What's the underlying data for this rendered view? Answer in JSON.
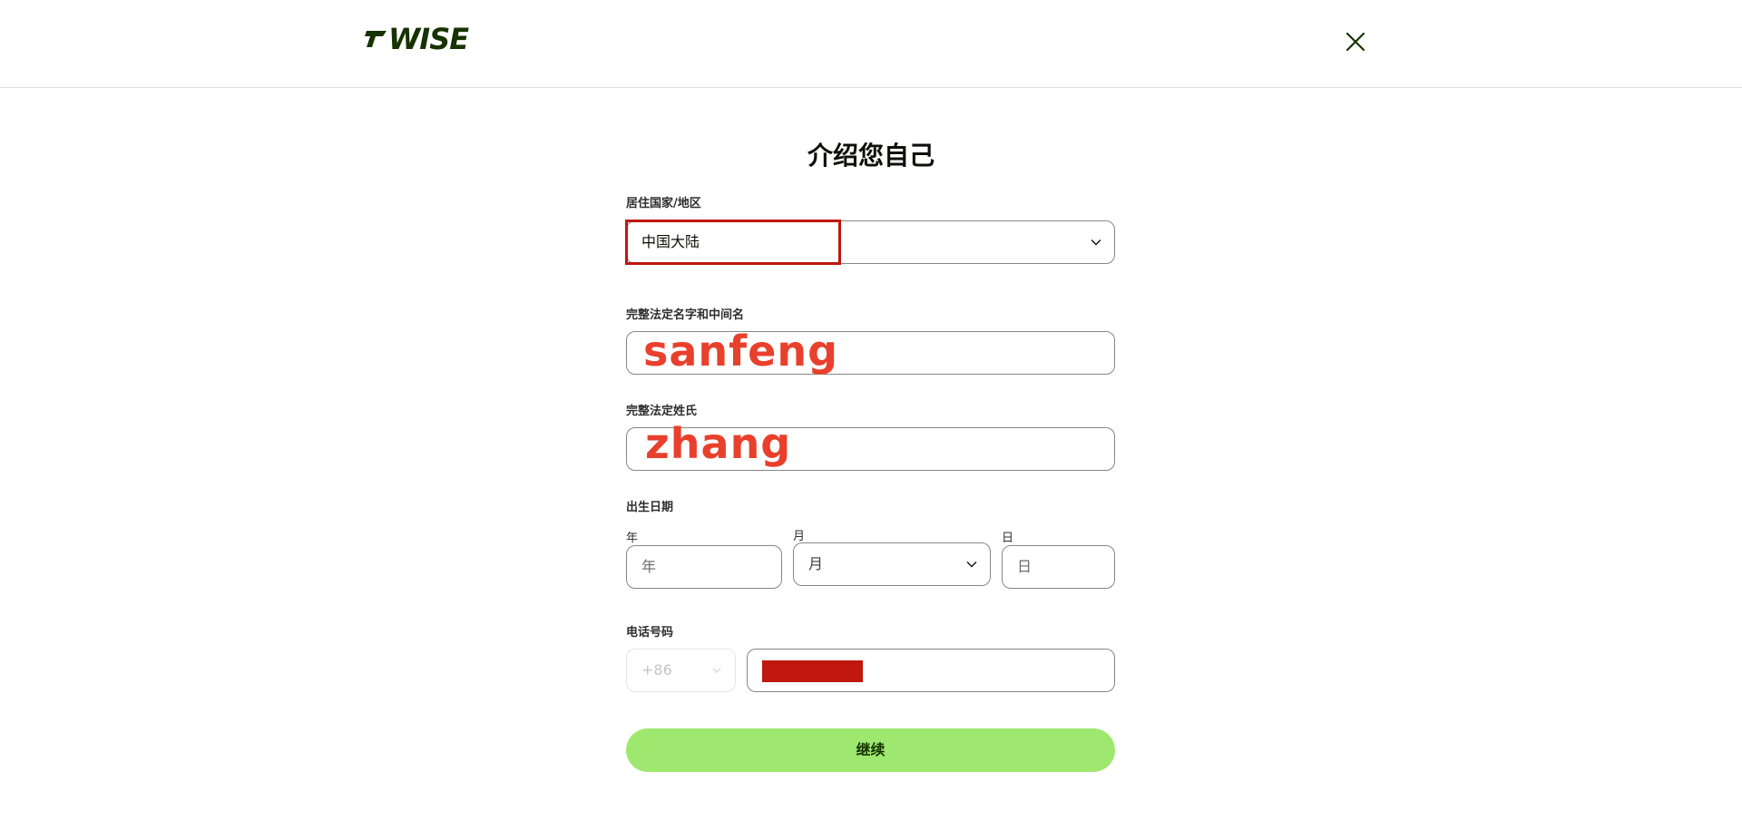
{
  "header": {
    "logo_mark": "⁷",
    "logo_text": "WISE",
    "close_icon": "close-icon"
  },
  "form": {
    "title": "介绍您自己",
    "country": {
      "label": "居住国家/地区",
      "value": "中国大陆"
    },
    "first_name": {
      "label": "完整法定名字和中间名",
      "value": "sanfeng"
    },
    "last_name": {
      "label": "完整法定姓氏",
      "value": "zhang"
    },
    "dob": {
      "label": "出生日期",
      "year_label": "年",
      "year_placeholder": "年",
      "month_label": "月",
      "month_value": "月",
      "day_label": "日",
      "day_placeholder": "日"
    },
    "phone": {
      "label": "电话号码",
      "code": "+86"
    },
    "continue_label": "继续"
  },
  "colors": {
    "brand": "#163300",
    "button": "#9fe870",
    "highlight": "#c0170e",
    "input_text": "#e8402c"
  }
}
